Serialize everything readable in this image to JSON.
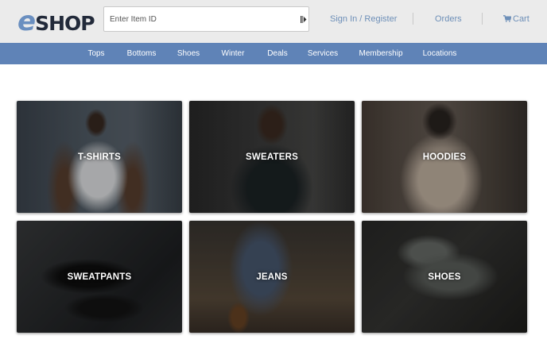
{
  "logo": {
    "first": "e",
    "rest": "SHOP"
  },
  "search": {
    "placeholder": "Enter Item ID",
    "value": ""
  },
  "header": {
    "signin": "Sign In / Register",
    "orders": "Orders",
    "cart": "Cart"
  },
  "nav": {
    "items": [
      "Tops",
      "Bottoms",
      "Shoes",
      "Winter",
      "Deals",
      "Services",
      "Membership",
      "Locations"
    ]
  },
  "categories": [
    {
      "label": "T-SHIRTS"
    },
    {
      "label": "SWEATERS"
    },
    {
      "label": "HOODIES"
    },
    {
      "label": "SWEATPANTS"
    },
    {
      "label": "JEANS"
    },
    {
      "label": "SHOES"
    }
  ],
  "colors": {
    "accent": "#5f83b7",
    "link": "#6d8fb8",
    "topbar": "#ebebeb",
    "logo_e": "#6a8fc0",
    "logo_shop": "#222a3a"
  },
  "icons": {
    "scan": "barcode-scan-icon",
    "cart": "cart-icon"
  }
}
